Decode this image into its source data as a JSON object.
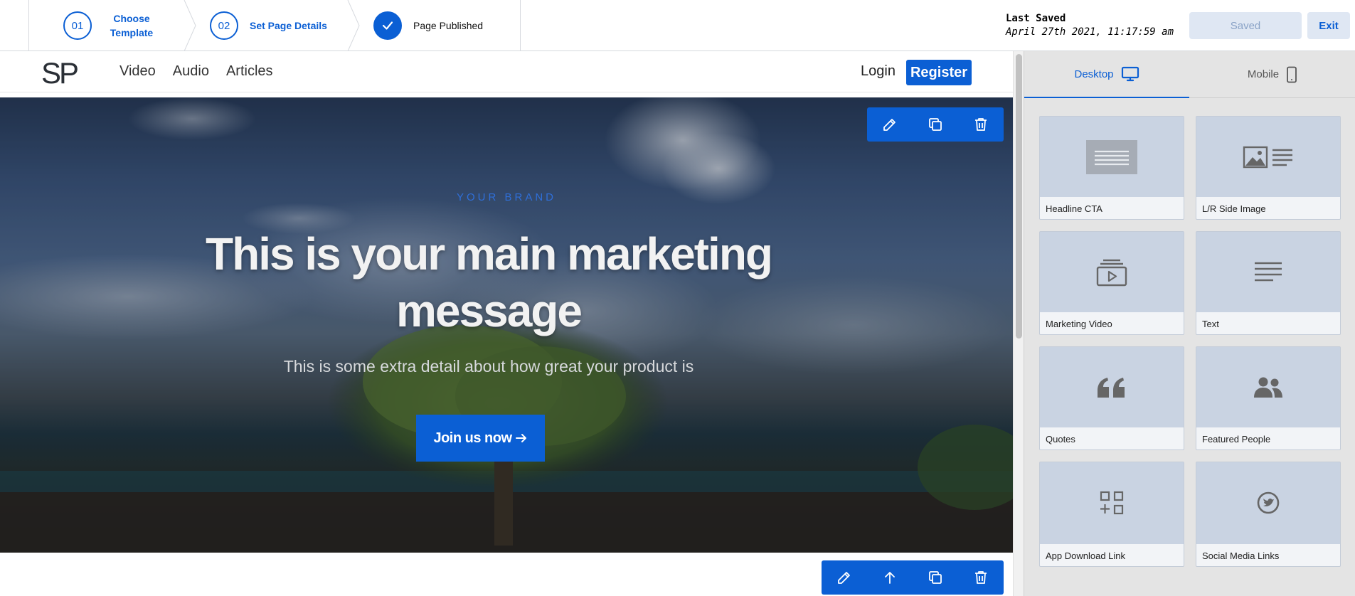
{
  "stepper": {
    "steps": [
      {
        "number": "01",
        "label": "Choose Template"
      },
      {
        "number": "02",
        "label": "Set Page Details"
      },
      {
        "number": "",
        "label": "Page Published"
      }
    ]
  },
  "save_status": {
    "title": "Last Saved",
    "timestamp": "April 27th 2021, 11:17:59 am",
    "saved_button": "Saved",
    "exit_button": "Exit"
  },
  "site": {
    "logo": "SP",
    "nav_links": [
      "Video",
      "Audio",
      "Articles"
    ],
    "login": "Login",
    "register": "Register"
  },
  "hero": {
    "brand": "YOUR BRAND",
    "title": "This is your main marketing message",
    "subtitle": "This is some extra detail about how great your product is",
    "cta": "Join us now",
    "cta_icon": "arrow-right-icon"
  },
  "section_toolbar_icons": [
    "edit-icon",
    "duplicate-icon",
    "delete-icon"
  ],
  "lower_toolbar_icons": [
    "edit-icon",
    "move-up-icon",
    "duplicate-icon",
    "delete-icon"
  ],
  "panel": {
    "tabs": [
      {
        "label": "Desktop",
        "icon": "desktop-icon",
        "active": true
      },
      {
        "label": "Mobile",
        "icon": "mobile-icon",
        "active": false
      }
    ],
    "blocks": [
      {
        "label": "Headline CTA",
        "icon": "headline-icon"
      },
      {
        "label": "L/R Side Image",
        "icon": "side-image-icon"
      },
      {
        "label": "Marketing Video",
        "icon": "video-icon"
      },
      {
        "label": "Text",
        "icon": "text-icon"
      },
      {
        "label": "Quotes",
        "icon": "quote-icon"
      },
      {
        "label": "Featured People",
        "icon": "people-icon"
      },
      {
        "label": "App Download Link",
        "icon": "app-download-icon"
      },
      {
        "label": "Social Media Links",
        "icon": "social-icon"
      }
    ]
  },
  "colors": {
    "accent": "#0b5fd4",
    "panel_bg": "#e4e4e4",
    "block_bg": "#c9d3e2"
  }
}
